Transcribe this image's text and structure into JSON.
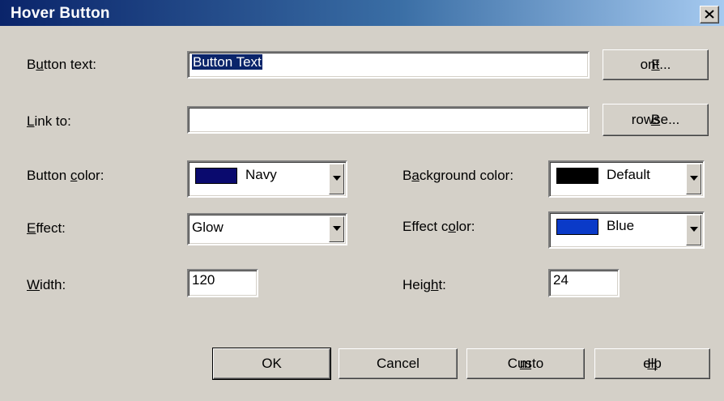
{
  "window": {
    "title": "Hover Button"
  },
  "fields": {
    "button_text": {
      "label_pre": "B",
      "label_u": "u",
      "label_post": "tton text:",
      "value": "Button Text"
    },
    "link_to": {
      "label_pre": "",
      "label_u": "L",
      "label_post": "ink to:",
      "value": ""
    },
    "button_color": {
      "label_pre": "Button ",
      "label_u": "c",
      "label_post": "olor:",
      "value": "Navy",
      "swatch": "#0a0a6e"
    },
    "background_color": {
      "label_pre": "B",
      "label_u": "a",
      "label_post": "ckground color:",
      "value": "Default",
      "swatch": "#000000"
    },
    "effect": {
      "label_pre": "",
      "label_u": "E",
      "label_post": "ffect:",
      "value": "Glow"
    },
    "effect_color": {
      "label_pre": "Effect c",
      "label_u": "o",
      "label_post": "lor:",
      "value": "Blue",
      "swatch": "#0a3ac8"
    },
    "width": {
      "label_pre": "",
      "label_u": "W",
      "label_post": "idth:",
      "value": "120"
    },
    "height": {
      "label_pre": "Heig",
      "label_u": "h",
      "label_post": "t:",
      "value": "24"
    }
  },
  "buttons": {
    "font": {
      "pre": "",
      "u": "F",
      "post": "ont..."
    },
    "browse": {
      "pre": "",
      "u": "B",
      "post": "rowse..."
    },
    "ok": {
      "pre": "OK",
      "u": "",
      "post": ""
    },
    "cancel": {
      "pre": "Cancel",
      "u": "",
      "post": ""
    },
    "custom": {
      "pre": "Custo",
      "u": "m",
      "post": "..."
    },
    "help": {
      "pre": "",
      "u": "H",
      "post": "elp"
    }
  }
}
